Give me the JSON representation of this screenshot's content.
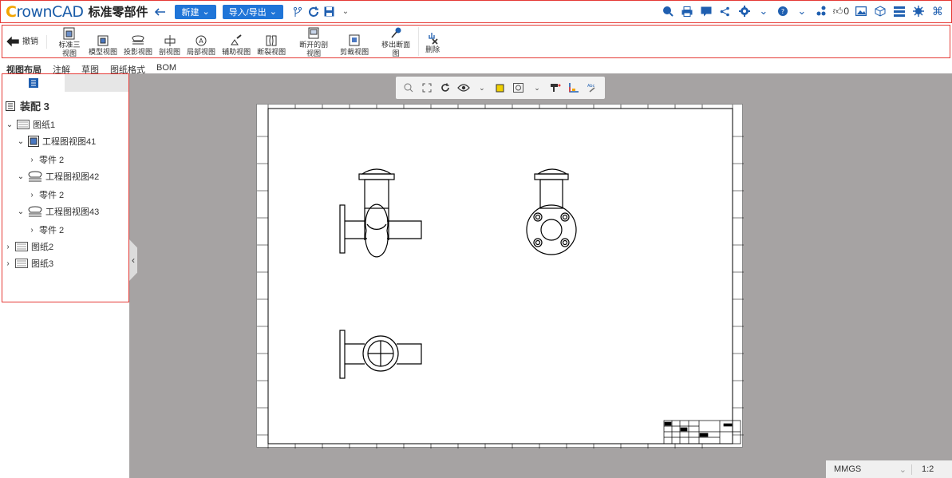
{
  "app": {
    "logo_c": "C",
    "logo_rest": "rownCAD",
    "document_title": "标准零部件",
    "new_button": "新建",
    "import_export_button": "导入/导出",
    "likes": "0"
  },
  "ribbon": {
    "undo": "撤销",
    "items": [
      {
        "label": "标准三视图"
      },
      {
        "label": "模型视图"
      },
      {
        "label": "投影视图"
      },
      {
        "label": "剖视图"
      },
      {
        "label": "局部视图"
      },
      {
        "label": "辅助视图"
      },
      {
        "label": "断裂视图"
      },
      {
        "label": "断开的剖视图"
      },
      {
        "label": "剪裁视图"
      },
      {
        "label": "移出断面图"
      },
      {
        "label": "删除"
      }
    ]
  },
  "tabs": [
    "视图布局",
    "注解",
    "草图",
    "图纸格式",
    "BOM"
  ],
  "tree": {
    "root": "装配 3",
    "sheet1": "图纸1",
    "view41": "工程图视图41",
    "part41": "零件 2",
    "view42": "工程图视图42",
    "part42": "零件 2",
    "view43": "工程图视图43",
    "part43": "零件 2",
    "sheet2": "图纸2",
    "sheet3": "图纸3"
  },
  "status": {
    "units": "MMGS",
    "scale": "1:2"
  },
  "colors": {
    "accent": "#1f75d8",
    "highlight_border": "#e53935",
    "canvas_bg": "#a6a3a3"
  }
}
